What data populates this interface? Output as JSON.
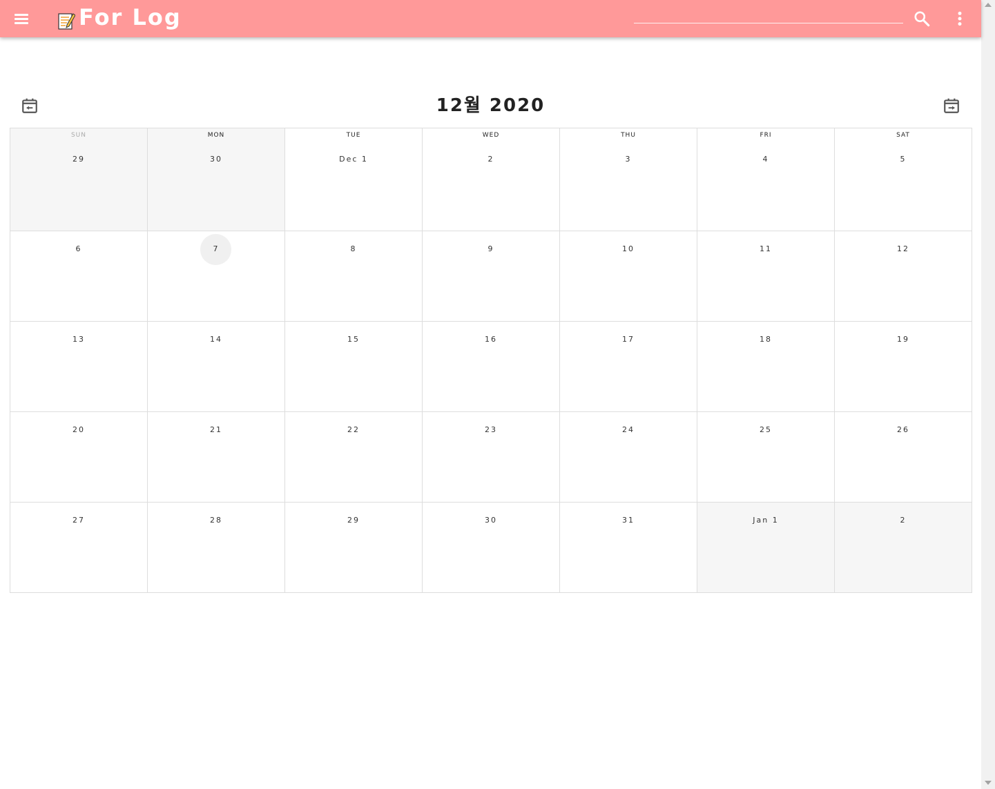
{
  "app": {
    "title": "For Log",
    "brand_color": "#ff9999",
    "icons": {
      "menu": "menu-icon",
      "logo": "memo-icon",
      "search": "search-icon",
      "more": "more-vert-icon"
    }
  },
  "search": {
    "value": "",
    "placeholder": ""
  },
  "calendar": {
    "title": "12월 2020",
    "prev_icon": "calendar-prev-icon",
    "next_icon": "calendar-next-icon",
    "weekdays": [
      "SUN",
      "MON",
      "TUE",
      "WED",
      "THU",
      "FRI",
      "SAT"
    ],
    "weeks": [
      [
        "29",
        "30",
        "Dec 1",
        "2",
        "3",
        "4",
        "5"
      ],
      [
        "6",
        "7",
        "8",
        "9",
        "10",
        "11",
        "12"
      ],
      [
        "13",
        "14",
        "15",
        "16",
        "17",
        "18",
        "19"
      ],
      [
        "20",
        "21",
        "22",
        "23",
        "24",
        "25",
        "26"
      ],
      [
        "27",
        "28",
        "29",
        "30",
        "31",
        "Jan 1",
        "2"
      ]
    ],
    "today": "7"
  }
}
